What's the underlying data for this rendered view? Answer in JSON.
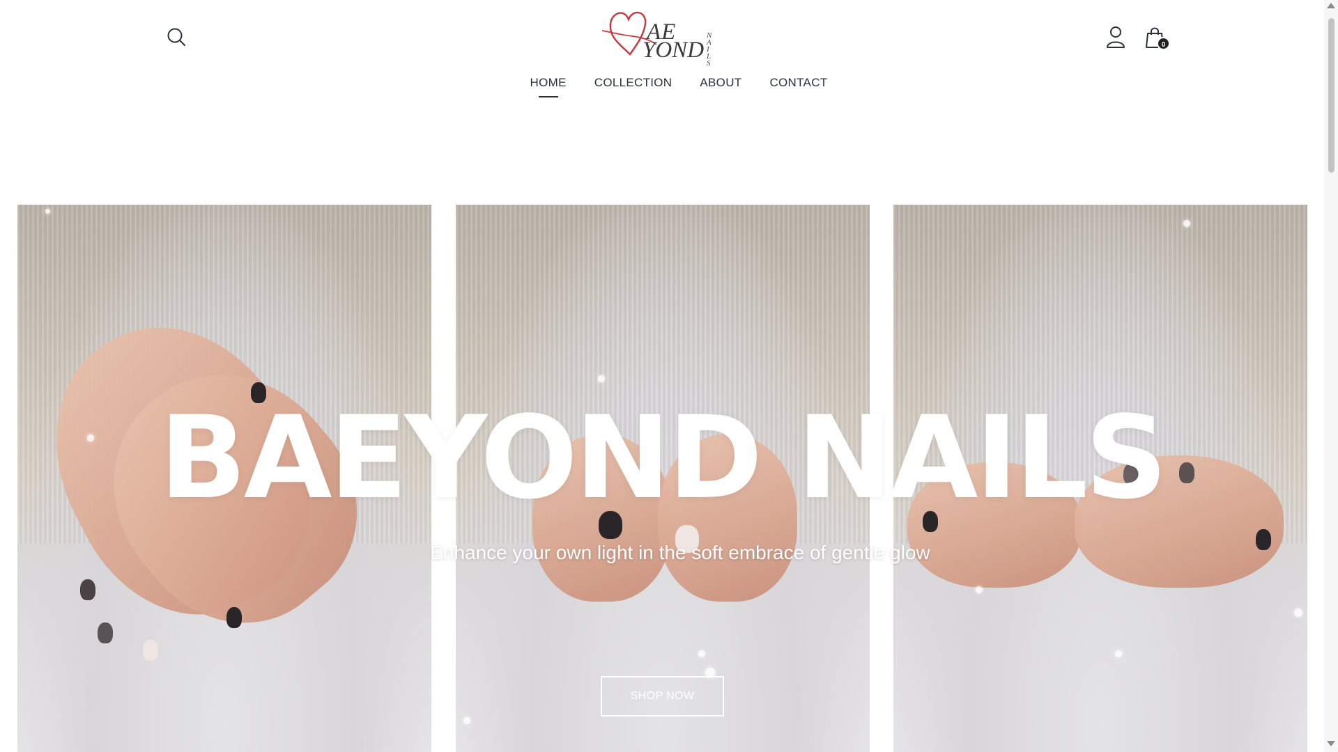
{
  "header": {
    "logo": {
      "text_top": "AE",
      "text_bottom": "YOND",
      "text_side": "NAILS",
      "heart_color": "#c8363d"
    },
    "cart": {
      "count": "0"
    },
    "nav": {
      "items": [
        {
          "label": "HOME",
          "active": true
        },
        {
          "label": "COLLECTION",
          "active": false
        },
        {
          "label": "ABOUT",
          "active": false
        },
        {
          "label": "CONTACT",
          "active": false
        }
      ]
    },
    "icons": {
      "search": "search-icon",
      "account": "user-icon",
      "cart": "shopping-bag-icon"
    }
  },
  "hero": {
    "title": "BAEYOND NAILS",
    "subtitle": "Enhance your own light in the soft embrace of gentle glow",
    "cta_label": "SHOP NOW"
  },
  "colors": {
    "text": "#2b2f3a",
    "background": "#ffffff",
    "accent": "#c8363d"
  }
}
